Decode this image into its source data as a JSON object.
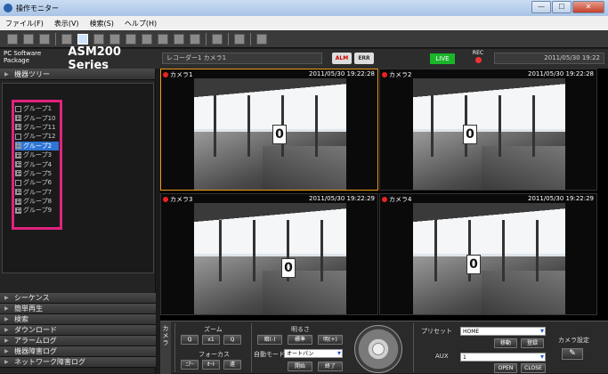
{
  "window": {
    "title": "操作モニター",
    "min_label": "—",
    "max_label": "☐",
    "close_label": "✕"
  },
  "menu": {
    "items": [
      "ファイル(F)",
      "表示(V)",
      "検索(S)",
      "ヘルプ(H)"
    ]
  },
  "header": {
    "package": "PC Software Package",
    "model": "ASM200 Series",
    "recorder_camera": "レコーダー1 カメラ1",
    "alm_label": "ALM",
    "err_label": "ERR",
    "live_label": "LIVE",
    "rec_label": "REC",
    "datetime": "2011/05/30 19:22"
  },
  "sidebar": {
    "device_tree_label": "機器ツリー",
    "group_label": "グループ",
    "groups": [
      {
        "label": "グループ1",
        "icon": "single"
      },
      {
        "label": "グループ10",
        "icon": "grid"
      },
      {
        "label": "グループ11",
        "icon": "grid"
      },
      {
        "label": "グループ12",
        "icon": "single"
      },
      {
        "label": "グループ2",
        "icon": "grid",
        "selected": true
      },
      {
        "label": "グループ3",
        "icon": "grid"
      },
      {
        "label": "グループ4",
        "icon": "grid"
      },
      {
        "label": "グループ5",
        "icon": "grid"
      },
      {
        "label": "グループ6",
        "icon": "single"
      },
      {
        "label": "グループ7",
        "icon": "grid"
      },
      {
        "label": "グループ8",
        "icon": "grid"
      },
      {
        "label": "グループ9",
        "icon": "grid"
      }
    ],
    "bottom_sections": [
      "シーケンス",
      "簡単再生",
      "検索",
      "ダウンロード",
      "アラームログ",
      "機器障害ログ",
      "ネットワーク障害ログ"
    ]
  },
  "cameras": [
    {
      "name": "カメラ1",
      "time": "2011/05/30 19:22:28",
      "active": true,
      "sign": "0"
    },
    {
      "name": "カメラ2",
      "time": "2011/05/30 19:22:28",
      "active": false,
      "sign": "0"
    },
    {
      "name": "カメラ3",
      "time": "2011/05/30 19:22:29",
      "active": false,
      "sign": "0"
    },
    {
      "name": "カメラ4",
      "time": "2011/05/30 19:22:29",
      "active": false,
      "sign": "0"
    }
  ],
  "controls": {
    "camera_vertical": "カメラ",
    "zoom_label": "ズーム",
    "zoom_out": "Q",
    "zoom_x1": "x1",
    "zoom_in": "Q",
    "focus_label": "フォーカス",
    "focus_near": "ﾆｱｰ",
    "focus_auto": "ｵｰﾄ",
    "focus_far": "遠",
    "brightness_label": "明るさ",
    "dark": "暗(-)",
    "standard": "標準",
    "bright": "明(+)",
    "auto_mode_label": "自動モード",
    "auto_mode_value": "オートパン",
    "start": "開始",
    "end": "終了",
    "preset_label": "プリセット",
    "preset_value": "HOME",
    "move": "移動",
    "register": "登録",
    "aux_label": "AUX",
    "aux_value": "1",
    "open": "OPEN",
    "close": "CLOSE",
    "camera_settings": "カメラ設定",
    "settings_icon": "✎"
  }
}
